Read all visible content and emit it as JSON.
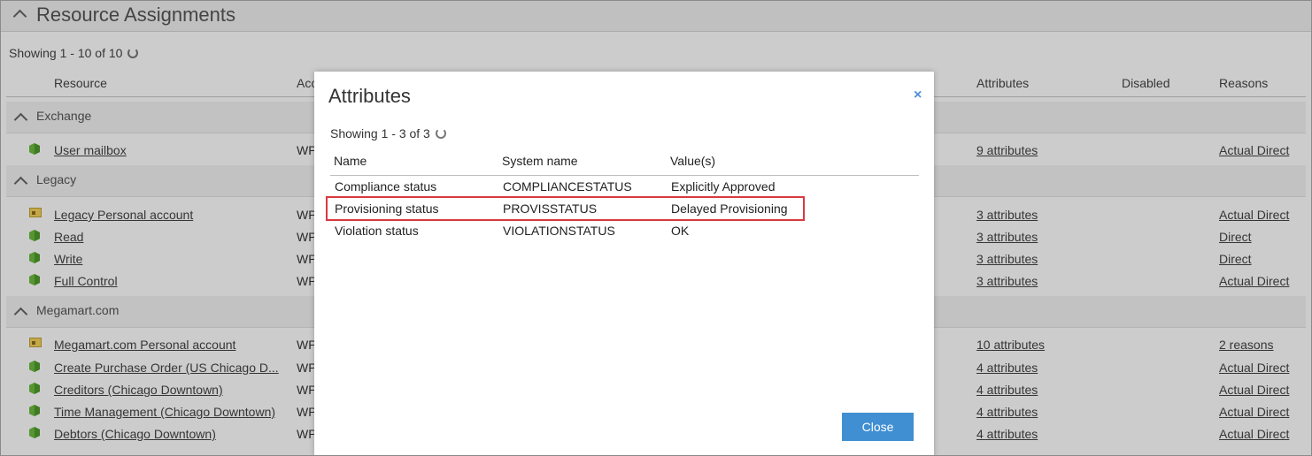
{
  "page": {
    "title": "Resource Assignments",
    "showing": "Showing 1 - 10 of 10",
    "columns": {
      "resource": "Resource",
      "account": "Acc",
      "attributes": "Attributes",
      "disabled": "Disabled",
      "reasons": "Reasons"
    }
  },
  "groups": [
    {
      "label": "Exchange",
      "rows": [
        {
          "name": "User mailbox",
          "account": "WP",
          "attributes": "9 attributes",
          "reasons": "Actual Direct",
          "icon": "package-icon"
        }
      ]
    },
    {
      "label": "Legacy",
      "rows": [
        {
          "name": "Legacy Personal account",
          "account": "WP",
          "attributes": "3 attributes",
          "reasons": "Actual Direct",
          "icon": "account-icon"
        },
        {
          "name": "Read",
          "account": "WP",
          "attributes": "3 attributes",
          "reasons": "Direct",
          "icon": "package-icon"
        },
        {
          "name": "Write",
          "account": "WP",
          "attributes": "3 attributes",
          "reasons": "Direct",
          "icon": "package-icon"
        },
        {
          "name": "Full Control",
          "account": "WP",
          "attributes": "3 attributes",
          "reasons": "Actual Direct",
          "icon": "package-icon"
        }
      ]
    },
    {
      "label": "Megamart.com",
      "rows": [
        {
          "name": "Megamart.com Personal account",
          "account": "WP",
          "attributes": "10 attributes",
          "reasons": "2 reasons",
          "icon": "account-icon"
        },
        {
          "name": "Create Purchase Order (US Chicago D...",
          "account": "WP",
          "attributes": "4 attributes",
          "reasons": "Actual Direct",
          "icon": "package-icon"
        },
        {
          "name": "Creditors (Chicago Downtown)",
          "account": "WP",
          "attributes": "4 attributes",
          "reasons": "Actual Direct",
          "icon": "package-icon"
        },
        {
          "name": "Time Management (Chicago Downtown)",
          "account": "WP",
          "attributes": "4 attributes",
          "reasons": "Actual Direct",
          "icon": "package-icon"
        },
        {
          "name": "Debtors (Chicago Downtown)",
          "account": "WP",
          "attributes": "4 attributes",
          "reasons": "Actual Direct",
          "icon": "package-icon"
        }
      ]
    }
  ],
  "dialog": {
    "title": "Attributes",
    "close_icon": "×",
    "showing": "Showing 1 - 3 of 3",
    "columns": {
      "name": "Name",
      "system": "System name",
      "values": "Value(s)"
    },
    "rows": [
      {
        "name": "Compliance status",
        "system": "COMPLIANCESTATUS",
        "value": "Explicitly Approved"
      },
      {
        "name": "Provisioning status",
        "system": "PROVISSTATUS",
        "value": "Delayed Provisioning"
      },
      {
        "name": "Violation status",
        "system": "VIOLATIONSTATUS",
        "value": "OK"
      }
    ],
    "close_label": "Close"
  },
  "colors": {
    "accent": "#3f8fd2",
    "highlight": "#d9393f",
    "cube": "#4e9a2b"
  }
}
